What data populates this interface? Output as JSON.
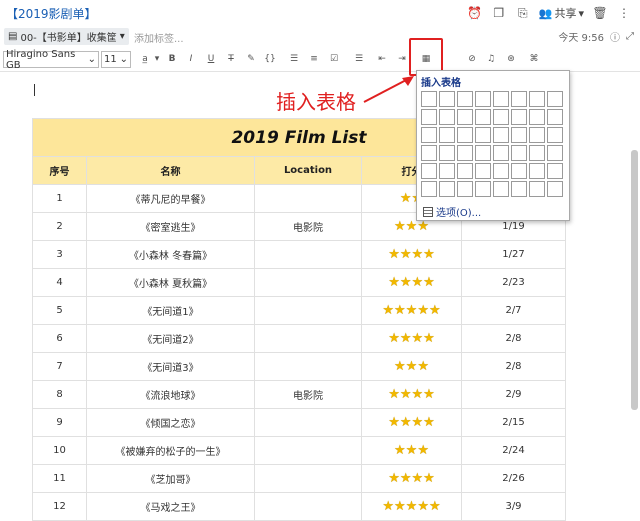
{
  "window": {
    "title": "【2019影剧单】",
    "share_label": "共享",
    "icons": [
      "alarm-clock-icon",
      "copy-icon",
      "export-icon",
      "share-people-icon",
      "trash-icon",
      "more-icon"
    ]
  },
  "tagbar": {
    "notebook_label": "00-【书影单】收集筐",
    "add_tag_placeholder": "添加标签...",
    "modified_time": "今天 9:56"
  },
  "toolbar": {
    "font_family": "Hiragino Sans GB",
    "font_size": "11",
    "buttons": [
      "font-color",
      "bold",
      "italic",
      "underline",
      "strikethrough",
      "highlight",
      "code",
      "bullet-list",
      "numbered-list",
      "checkbox",
      "indent-decrease",
      "indent-increase",
      "insert-table",
      "attachment",
      "voice",
      "more",
      "link"
    ]
  },
  "annotation": "插入表格",
  "table_popup": {
    "title": "插入表格",
    "rows": 6,
    "cols": 8,
    "options_label": "选项(O)..."
  },
  "film_table": {
    "title": "2019 Film List",
    "headers": [
      "序号",
      "名称",
      "Location",
      "打分",
      ""
    ],
    "rows": [
      {
        "no": "1",
        "name": "《蒂凡尼的早餐》",
        "location": "",
        "stars": 2,
        "date": ""
      },
      {
        "no": "2",
        "name": "《密室逃生》",
        "location": "电影院",
        "stars": 3,
        "date": "1/19"
      },
      {
        "no": "3",
        "name": "《小森林 冬春篇》",
        "location": "",
        "stars": 4,
        "date": "1/27"
      },
      {
        "no": "4",
        "name": "《小森林 夏秋篇》",
        "location": "",
        "stars": 4,
        "date": "2/23"
      },
      {
        "no": "5",
        "name": "《无间道1》",
        "location": "",
        "stars": 5,
        "date": "2/7"
      },
      {
        "no": "6",
        "name": "《无间道2》",
        "location": "",
        "stars": 4,
        "date": "2/8"
      },
      {
        "no": "7",
        "name": "《无间道3》",
        "location": "",
        "stars": 3,
        "date": "2/8"
      },
      {
        "no": "8",
        "name": "《流浪地球》",
        "location": "电影院",
        "stars": 4,
        "date": "2/9"
      },
      {
        "no": "9",
        "name": "《倾国之恋》",
        "location": "",
        "stars": 4,
        "date": "2/15"
      },
      {
        "no": "10",
        "name": "《被嫌弃的松子的一生》",
        "location": "",
        "stars": 3,
        "date": "2/24"
      },
      {
        "no": "11",
        "name": "《芝加哥》",
        "location": "",
        "stars": 4,
        "date": "2/26"
      },
      {
        "no": "12",
        "name": "《马戏之王》",
        "location": "",
        "stars": 5,
        "date": "3/9"
      }
    ]
  },
  "colors": {
    "title_row_bg": "#fde69a",
    "header_row_bg": "#fdeaa6",
    "annotation_red": "#e02020",
    "star_gold": "#f2b800"
  }
}
